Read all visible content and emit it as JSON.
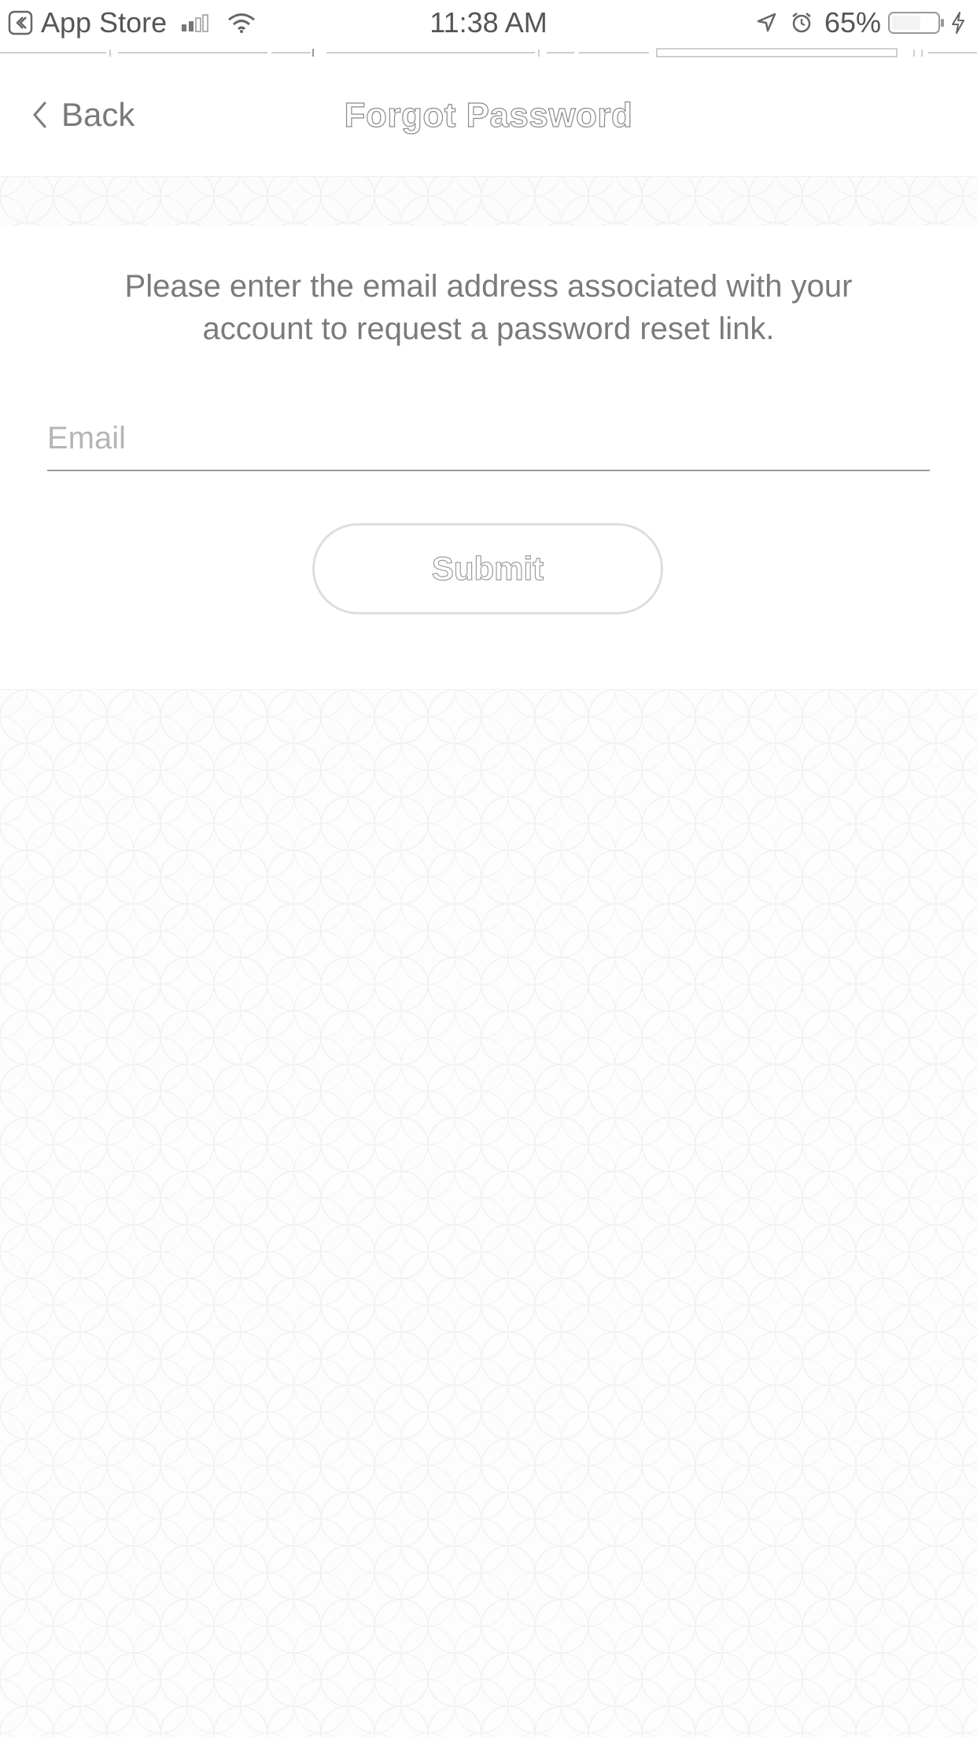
{
  "status_bar": {
    "back_app_label": "App Store",
    "time": "11:38 AM",
    "battery_percent": "65%",
    "icons": [
      "back-to-app-icon",
      "signal-icon",
      "wifi-icon",
      "location-icon",
      "alarm-icon",
      "battery-icon",
      "charging-icon"
    ]
  },
  "nav": {
    "back_label": "Back",
    "title": "Forgot Password"
  },
  "form": {
    "instructions": "Please enter the email address associated with your account to request a password reset link.",
    "email_value": "",
    "email_placeholder": "Email",
    "submit_label": "Submit"
  },
  "colors": {
    "background": "#ffffff",
    "text": "#7b7b7b",
    "placeholder": "#b5b5b5",
    "button_border": "#dedede",
    "pattern_line": "#efefef"
  }
}
